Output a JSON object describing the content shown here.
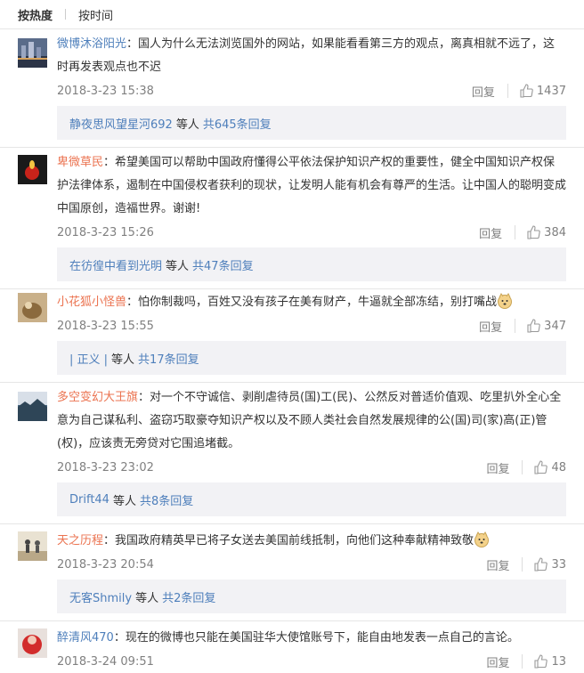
{
  "tabs": {
    "hot": "按热度",
    "time": "按时间"
  },
  "comments": [
    {
      "user": "微博沐浴阳光",
      "text": "：国人为什么无法浏览国外的网站，如果能看看第三方的观点，离真相就不远了，这时再发表观点也不迟",
      "time": "2018-3-23 15:38",
      "reply": "回复",
      "likes": "1437",
      "sub": {
        "who": "静夜思风望星河692",
        "mid": "等人",
        "total": "共645条回复"
      }
    },
    {
      "user": "卑微草民",
      "text": "：希望美国可以帮助中国政府懂得公平依法保护知识产权的重要性，健全中国知识产权保护法律体系，遏制在中国侵权者获利的现状，让发明人能有机会有尊严的生活。让中国人的聪明变成中国原创，造福世界。谢谢!",
      "time": "2018-3-23 15:26",
      "reply": "回复",
      "likes": "384",
      "sub": {
        "who": "在彷徨中看到光明",
        "mid": "等人",
        "total": "共47条回复"
      }
    },
    {
      "user": "小花狐小怪兽",
      "text": "：怕你制裁吗，百姓又没有孩子在美有财产，牛逼就全部冻结，别打嘴战",
      "time": "2018-3-23 15:55",
      "reply": "回复",
      "likes": "347",
      "sub": {
        "who": "| 正义 |",
        "mid": "等人",
        "total": "共17条回复"
      }
    },
    {
      "user": "多空变幻大王旗",
      "text": "：对一个不守诚信、剥削虐待员(国)工(民)、公然反对普适价值观、吃里扒外全心全意为自己谋私利、盗窃巧取豪夺知识产权以及不顾人类社会自然发展规律的公(国)司(家)高(正)管(权)，应该责无旁贷对它围追堵截。",
      "time": "2018-3-23 23:02",
      "reply": "回复",
      "likes": "48",
      "sub": {
        "who": "Drift44",
        "mid": "等人",
        "total": "共8条回复"
      }
    },
    {
      "user": "天之历程",
      "text": "：我国政府精英早已将子女送去美国前线抵制，向他们这种奉献精神致敬",
      "time": "2018-3-23 20:54",
      "reply": "回复",
      "likes": "33",
      "sub": {
        "who": "无客Shmily",
        "mid": "等人",
        "total": "共2条回复"
      }
    },
    {
      "user": "醉清风470",
      "text": "：现在的微博也只能在美国驻华大使馆账号下，能自由地发表一点自己的言论。",
      "time": "2018-3-24 09:51",
      "reply": "回复",
      "likes": "13"
    }
  ],
  "colors": {
    "user_orange": "#eb7350",
    "user_blue": "#4e7fbb",
    "meta_gray": "#808080",
    "sub_bg": "#f2f2f5"
  }
}
